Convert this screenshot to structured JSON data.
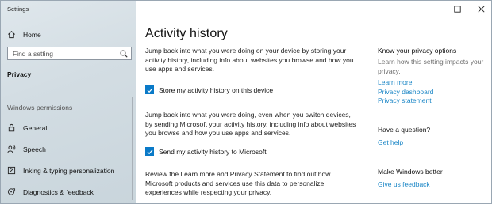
{
  "window": {
    "title": "Settings"
  },
  "sidebar": {
    "home_label": "Home",
    "search_placeholder": "Find a setting",
    "section_title": "Privacy",
    "group_title": "Windows permissions",
    "items": [
      {
        "label": "General",
        "icon": "lock-icon"
      },
      {
        "label": "Speech",
        "icon": "speech-icon"
      },
      {
        "label": "Inking & typing personalization",
        "icon": "inking-icon"
      },
      {
        "label": "Diagnostics & feedback",
        "icon": "diagnostics-icon"
      }
    ]
  },
  "main": {
    "title": "Activity history",
    "para1": "Jump back into what you were doing on your device by storing your activity history, including info about websites you browse and how you use apps and services.",
    "check1_label": "Store my activity history on this device",
    "check1_checked": true,
    "para2": "Jump back into what you were doing, even when you switch devices, by sending Microsoft your activity history, including info about websites you browse and how you use apps and services.",
    "check2_label": "Send my activity history to Microsoft",
    "check2_checked": true,
    "para3": "Review the Learn more and Privacy Statement to find out how Microsoft products and services use this data to personalize experiences while respecting your privacy."
  },
  "right": {
    "privacy_heading": "Know your privacy options",
    "privacy_text": "Learn how this setting impacts your privacy.",
    "links": [
      "Learn more",
      "Privacy dashboard",
      "Privacy statement"
    ],
    "question_heading": "Have a question?",
    "help_link": "Get help",
    "better_heading": "Make Windows better",
    "feedback_link": "Give us feedback"
  },
  "colors": {
    "accent": "#0a7ac8",
    "link": "#1a86c6",
    "sidebar_bg": "#d3dde3"
  }
}
